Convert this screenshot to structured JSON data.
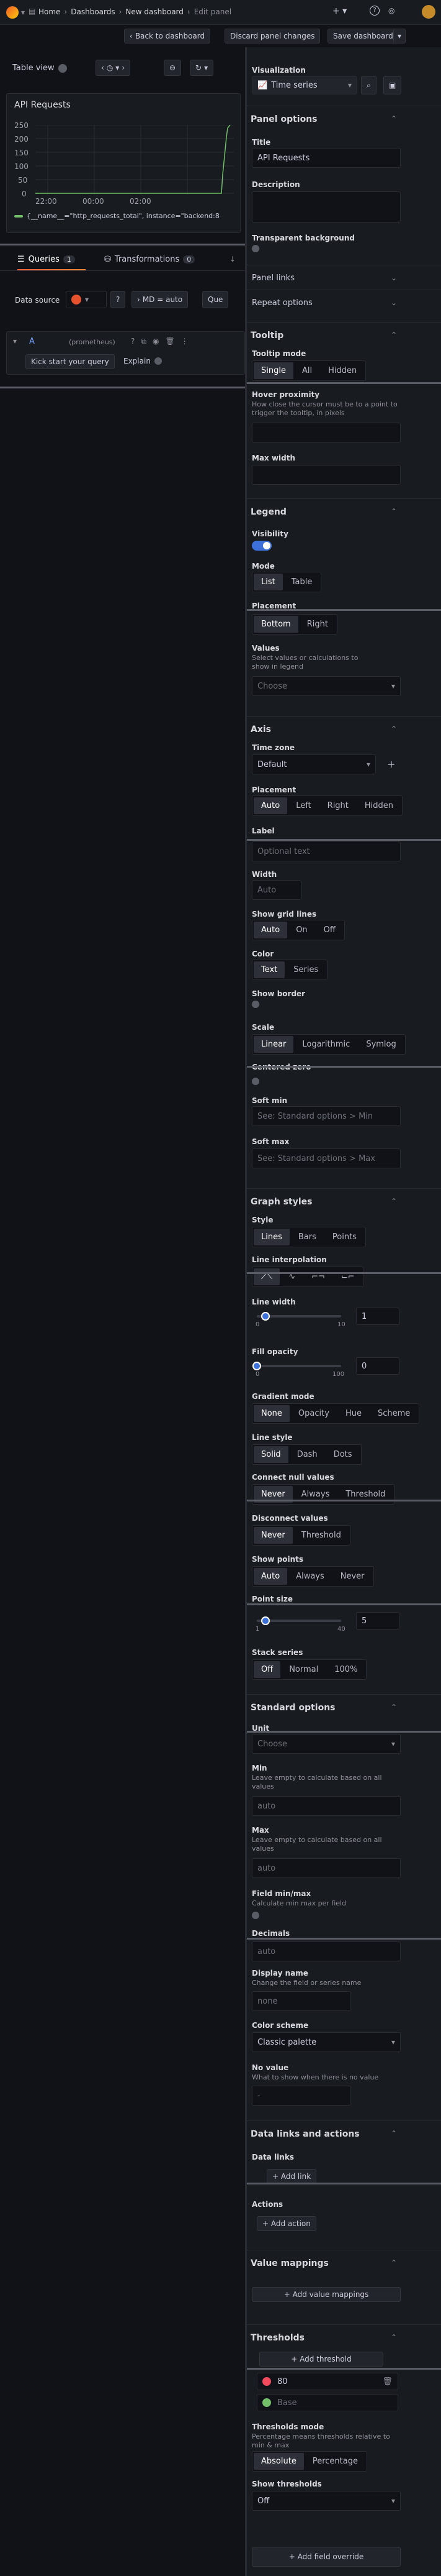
{
  "topbar": {
    "breadcrumb": [
      "Home",
      "Dashboards",
      "New dashboard",
      "Edit panel"
    ],
    "plus_label": "+",
    "back_label": "Back to dashboard",
    "discard_label": "Discard panel changes",
    "save_label": "Save dashboard"
  },
  "panel_toolbar": {
    "table_view_label": "Table view"
  },
  "graph": {
    "title": "API Requests",
    "y_ticks": [
      "250",
      "200",
      "150",
      "100",
      "50",
      "0"
    ],
    "x_ticks": [
      "22:00",
      "00:00",
      "02:00"
    ],
    "legend": "{__name__=\"http_requests_total\", instance=\"backend:8"
  },
  "query_tabs": {
    "queries_label": "Queries",
    "queries_count": "1",
    "transform_label": "Transformations",
    "transform_count": "0"
  },
  "datasource": {
    "label": "Data source",
    "options": "MD = auto",
    "query_inspector": "Que"
  },
  "query_row": {
    "ref": "A",
    "ds_name": "(prometheus)",
    "kick_label": "Kick start your query",
    "explain_label": "Explain"
  },
  "viz": {
    "label": "Visualization",
    "selected": "Time series"
  },
  "panel_options": {
    "header": "Panel options",
    "title_label": "Title",
    "title_value": "API Requests",
    "description_label": "Description",
    "transparent_label": "Transparent background",
    "panel_links": "Panel links",
    "repeat_options": "Repeat options"
  },
  "tooltip": {
    "header": "Tooltip",
    "mode_label": "Tooltip mode",
    "modes": [
      "Single",
      "All",
      "Hidden"
    ],
    "hover_label": "Hover proximity",
    "hover_desc": "How close the cursor must be to a point to trigger the tooltip, in pixels",
    "maxwidth_label": "Max width"
  },
  "legend": {
    "header": "Legend",
    "visibility_label": "Visibility",
    "mode_label": "Mode",
    "modes": [
      "List",
      "Table"
    ],
    "placement_label": "Placement",
    "placements": [
      "Bottom",
      "Right"
    ],
    "values_label": "Values",
    "values_desc": "Select values or calculations to show in legend",
    "values_placeholder": "Choose"
  },
  "axis": {
    "header": "Axis",
    "timezone_label": "Time zone",
    "timezone_value": "Default",
    "placement_label": "Placement",
    "placements": [
      "Auto",
      "Left",
      "Right",
      "Hidden"
    ],
    "label_label": "Label",
    "label_placeholder": "Optional text",
    "width_label": "Width",
    "width_placeholder": "Auto",
    "grid_label": "Show grid lines",
    "grid_opts": [
      "Auto",
      "On",
      "Off"
    ],
    "color_label": "Color",
    "color_opts": [
      "Text",
      "Series"
    ],
    "border_label": "Show border",
    "scale_label": "Scale",
    "scale_opts": [
      "Linear",
      "Logarithmic",
      "Symlog"
    ],
    "centered_label": "Centered zero",
    "softmin_label": "Soft min",
    "softmin_placeholder": "See: Standard options > Min",
    "softmax_label": "Soft max",
    "softmax_placeholder": "See: Standard options > Max"
  },
  "graph_styles": {
    "header": "Graph styles",
    "style_label": "Style",
    "styles": [
      "Lines",
      "Bars",
      "Points"
    ],
    "interp_label": "Line interpolation",
    "linewidth_label": "Line width",
    "linewidth_value": "1",
    "linewidth_min": "0",
    "linewidth_max": "10",
    "linewidth_fraction": 0.1,
    "fill_label": "Fill opacity",
    "fill_value": "0",
    "fill_min": "0",
    "fill_max": "100",
    "fill_fraction": 0.0,
    "gradient_label": "Gradient mode",
    "gradients": [
      "None",
      "Opacity",
      "Hue",
      "Scheme"
    ],
    "linestyle_label": "Line style",
    "linestyles": [
      "Solid",
      "Dash",
      "Dots"
    ],
    "connect_label": "Connect null values",
    "connect_opts": [
      "Never",
      "Always",
      "Threshold"
    ],
    "disconnect_label": "Disconnect values",
    "disconnect_opts": [
      "Never",
      "Threshold"
    ],
    "points_label": "Show points",
    "points_opts": [
      "Auto",
      "Always",
      "Never"
    ],
    "pointsize_label": "Point size",
    "pointsize_value": "5",
    "pointsize_min": "1",
    "pointsize_max": "40",
    "pointsize_fraction": 0.1,
    "stack_label": "Stack series",
    "stack_opts": [
      "Off",
      "Normal",
      "100%"
    ]
  },
  "standard": {
    "header": "Standard options",
    "unit_label": "Unit",
    "unit_placeholder": "Choose",
    "min_label": "Min",
    "min_desc": "Leave empty to calculate based on all values",
    "min_placeholder": "auto",
    "max_label": "Max",
    "max_desc": "Leave empty to calculate based on all values",
    "max_placeholder": "auto",
    "fieldminmax_label": "Field min/max",
    "fieldminmax_desc": "Calculate min max per field",
    "decimals_label": "Decimals",
    "decimals_placeholder": "auto",
    "displayname_label": "Display name",
    "displayname_desc": "Change the field or series name",
    "displayname_placeholder": "none",
    "colorscheme_label": "Color scheme",
    "colorscheme_value": "Classic palette",
    "novalue_label": "No value",
    "novalue_desc": "What to show when there is no value",
    "novalue_placeholder": "-"
  },
  "links": {
    "header": "Data links and actions",
    "datalinks_label": "Data links",
    "add_link": "+ Add link",
    "actions_label": "Actions",
    "add_action": "+ Add action"
  },
  "mappings": {
    "header": "Value mappings",
    "add_label": "+ Add value mappings"
  },
  "thresholds": {
    "header": "Thresholds",
    "add_label": "+ Add threshold",
    "red_value": "80",
    "base_label": "Base",
    "red_color": "#f2495c",
    "green_color": "#73bf69",
    "mode_label": "Thresholds mode",
    "mode_desc": "Percentage means thresholds relative to min & max",
    "modes": [
      "Absolute",
      "Percentage"
    ],
    "show_label": "Show thresholds",
    "show_value": "Off"
  },
  "override": {
    "add_label": "+ Add field override"
  }
}
